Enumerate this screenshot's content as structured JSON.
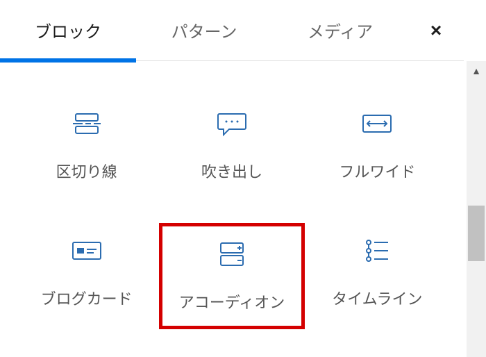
{
  "tabs": [
    {
      "label": "ブロック",
      "active": true
    },
    {
      "label": "パターン",
      "active": false
    },
    {
      "label": "メディア",
      "active": false
    }
  ],
  "close": "×",
  "blocks": [
    {
      "name": "divider",
      "label": "区切り線",
      "icon": "divider-icon",
      "highlighted": false
    },
    {
      "name": "balloon",
      "label": "吹き出し",
      "icon": "speech-icon",
      "highlighted": false
    },
    {
      "name": "fullwide",
      "label": "フルワイド",
      "icon": "fullwide-icon",
      "highlighted": false
    },
    {
      "name": "blogcard",
      "label": "ブログカード",
      "icon": "blogcard-icon",
      "highlighted": false
    },
    {
      "name": "accordion",
      "label": "アコーディオン",
      "icon": "accordion-icon",
      "highlighted": true
    },
    {
      "name": "timeline",
      "label": "タイムライン",
      "icon": "timeline-icon",
      "highlighted": false
    }
  ],
  "colors": {
    "accent": "#2b6cb0",
    "highlight": "#d40000"
  }
}
